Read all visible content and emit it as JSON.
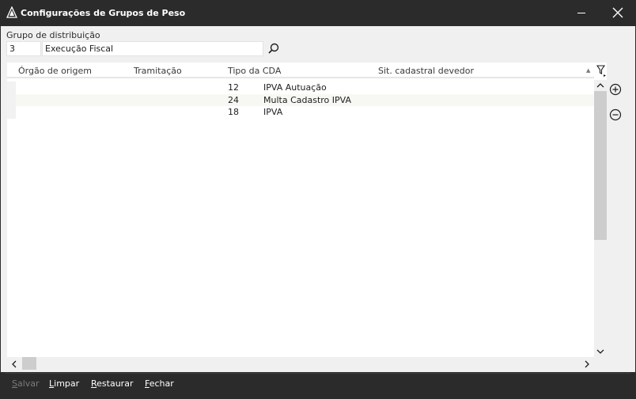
{
  "window": {
    "title": "Configurações de Grupos de Peso"
  },
  "form": {
    "grupo_label": "Grupo de distribuição",
    "grupo_code": "3",
    "grupo_name": "Execução Fiscal"
  },
  "grid": {
    "columns": [
      "Órgão de origem",
      "Tramitação",
      "Tipo da CDA",
      "Sit. cadastral devedor"
    ],
    "rows": [
      {
        "orgao": "",
        "tramitacao": "",
        "tipo_code": "12",
        "tipo_desc": "IPVA Autuação",
        "situacao": ""
      },
      {
        "orgao": "",
        "tramitacao": "",
        "tipo_code": "24",
        "tipo_desc": "Multa Cadastro IPVA",
        "situacao": ""
      },
      {
        "orgao": "",
        "tramitacao": "",
        "tipo_code": "18",
        "tipo_desc": "IPVA",
        "situacao": ""
      }
    ]
  },
  "footer": {
    "salvar": {
      "first": "S",
      "rest": "alvar"
    },
    "limpar": {
      "first": "L",
      "rest": "impar"
    },
    "restaurar": {
      "first": "R",
      "rest": "estaurar"
    },
    "fechar": {
      "first": "F",
      "rest": "echar"
    }
  },
  "icons": {
    "app": "app-logo-icon",
    "minimize": "minimize-icon",
    "close": "close-icon",
    "search": "search-icon",
    "filter": "filter-icon",
    "add": "add-circle-icon",
    "remove": "remove-circle-icon"
  },
  "colors": {
    "titlebar": "#2b2b2b",
    "client": "#f0f0f0",
    "alt_row": "#f7f7f3"
  }
}
